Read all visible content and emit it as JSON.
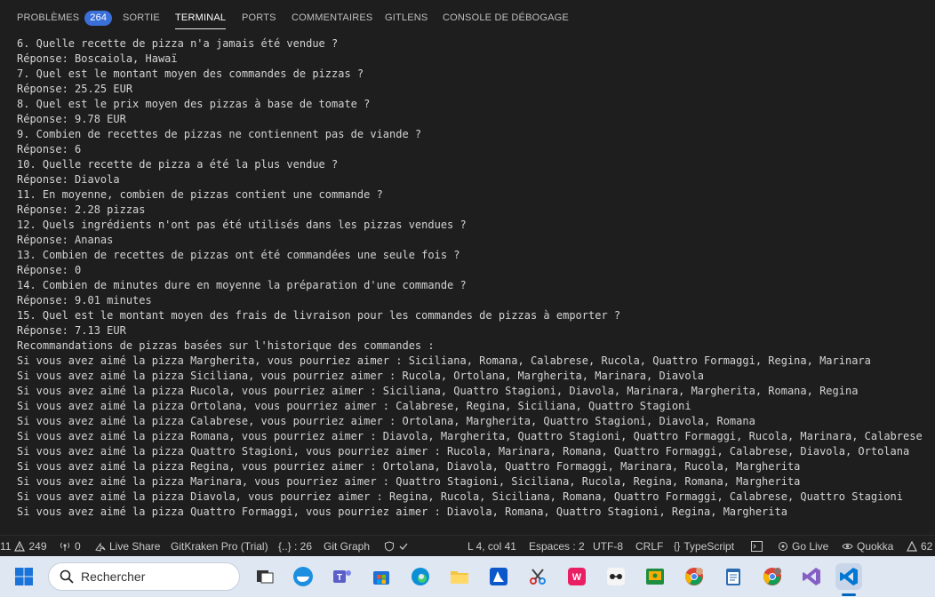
{
  "panel_tabs": [
    {
      "label": "PROBLÈMES",
      "badge": "264",
      "active": false
    },
    {
      "label": "SORTIE",
      "active": false
    },
    {
      "label": "TERMINAL",
      "active": true
    },
    {
      "label": "PORTS",
      "active": false
    },
    {
      "label": "COMMENTAIRES",
      "active": false
    },
    {
      "label": "GITLENS",
      "active": false
    },
    {
      "label": "CONSOLE DE DÉBOGAGE",
      "active": false
    }
  ],
  "terminal_lines": [
    "6. Quelle recette de pizza n'a jamais été vendue ?",
    "Réponse: Boscaiola, Hawaï",
    "7. Quel est le montant moyen des commandes de pizzas ?",
    "Réponse: 25.25 EUR",
    "8. Quel est le prix moyen des pizzas à base de tomate ?",
    "Réponse: 9.78 EUR",
    "9. Combien de recettes de pizzas ne contiennent pas de viande ?",
    "Réponse: 6",
    "10. Quelle recette de pizza a été la plus vendue ?",
    "Réponse: Diavola",
    "11. En moyenne, combien de pizzas contient une commande ?",
    "Réponse: 2.28 pizzas",
    "12. Quels ingrédients n'ont pas été utilisés dans les pizzas vendues ?",
    "Réponse: Ananas",
    "13. Combien de recettes de pizzas ont été commandées une seule fois ?",
    "Réponse: 0",
    "14. Combien de minutes dure en moyenne la préparation d'une commande ?",
    "Réponse: 9.01 minutes",
    "15. Quel est le montant moyen des frais de livraison pour les commandes de pizzas à emporter ?",
    "Réponse: 7.13 EUR",
    "Recommandations de pizzas basées sur l'historique des commandes :",
    "Si vous avez aimé la pizza Margherita, vous pourriez aimer : Siciliana, Romana, Calabrese, Rucola, Quattro Formaggi, Regina, Marinara",
    "Si vous avez aimé la pizza Siciliana, vous pourriez aimer : Rucola, Ortolana, Margherita, Marinara, Diavola",
    "Si vous avez aimé la pizza Rucola, vous pourriez aimer : Siciliana, Quattro Stagioni, Diavola, Marinara, Margherita, Romana, Regina",
    "Si vous avez aimé la pizza Ortolana, vous pourriez aimer : Calabrese, Regina, Siciliana, Quattro Stagioni",
    "Si vous avez aimé la pizza Calabrese, vous pourriez aimer : Ortolana, Margherita, Quattro Stagioni, Diavola, Romana",
    "Si vous avez aimé la pizza Romana, vous pourriez aimer : Diavola, Margherita, Quattro Stagioni, Quattro Formaggi, Rucola, Marinara, Calabrese",
    "Si vous avez aimé la pizza Quattro Stagioni, vous pourriez aimer : Rucola, Marinara, Romana, Quattro Formaggi, Calabrese, Diavola, Ortolana",
    "Si vous avez aimé la pizza Regina, vous pourriez aimer : Ortolana, Diavola, Quattro Formaggi, Marinara, Rucola, Margherita",
    "Si vous avez aimé la pizza Marinara, vous pourriez aimer : Quattro Stagioni, Siciliana, Rucola, Regina, Romana, Margherita",
    "Si vous avez aimé la pizza Diavola, vous pourriez aimer : Regina, Rucola, Siciliana, Romana, Quattro Formaggi, Calabrese, Quattro Stagioni",
    "Si vous avez aimé la pizza Quattro Formaggi, vous pourriez aimer : Diavola, Romana, Quattro Stagioni, Regina, Margherita"
  ],
  "status_bar": {
    "errors": "11",
    "warnings": "249",
    "ports": "0",
    "live_share": "Live Share",
    "gitkraken": "GitKraken Pro (Trial)",
    "brackets": "{..} : 26",
    "git_graph": "Git Graph",
    "cursor_position": "L 4, col 41",
    "spaces": "Espaces : 2",
    "encoding": "UTF-8",
    "line_ending": "CRLF",
    "language": "TypeScript",
    "go_live": "Go Live",
    "quokka": "Quokka",
    "notifications": "62"
  },
  "taskbar": {
    "search_placeholder": "Rechercher"
  }
}
